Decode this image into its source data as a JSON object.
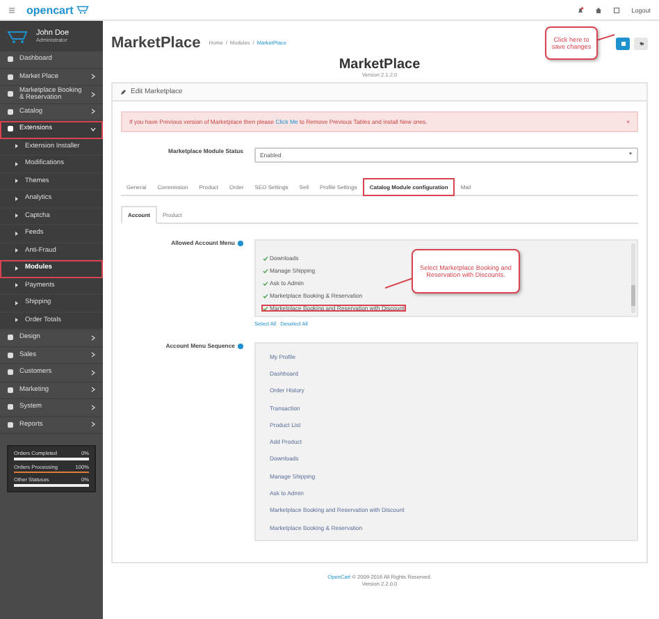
{
  "header": {
    "logo": "opencart",
    "logout": "Logout"
  },
  "user": {
    "name": "John Doe",
    "role": "Administrator"
  },
  "sidebar": {
    "items": [
      {
        "label": "Dashboard",
        "selected": false,
        "annotated": false
      },
      {
        "label": "Market Place",
        "expanded": false,
        "selected": false,
        "annotated": false
      },
      {
        "label": "Marketplace Booking & Reservation",
        "expanded": false,
        "selected": false,
        "annotated": false
      },
      {
        "label": "Catalog",
        "expanded": false,
        "selected": false,
        "annotated": false
      },
      {
        "label": "Extensions",
        "expanded": true,
        "selected": true,
        "annotated": true,
        "children": [
          {
            "label": "Extension Installer",
            "selected": false,
            "annotated": false
          },
          {
            "label": "Modifications",
            "selected": false,
            "annotated": false
          },
          {
            "label": "Themes",
            "selected": false,
            "annotated": false
          },
          {
            "label": "Analytics",
            "selected": false,
            "annotated": false
          },
          {
            "label": "Captcha",
            "selected": false,
            "annotated": false
          },
          {
            "label": "Feeds",
            "selected": false,
            "annotated": false
          },
          {
            "label": "Anti-Fraud",
            "selected": false,
            "annotated": false
          },
          {
            "label": "Modules",
            "selected": true,
            "annotated": true
          },
          {
            "label": "Payments",
            "selected": false,
            "annotated": false
          },
          {
            "label": "Shipping",
            "selected": false,
            "annotated": false
          },
          {
            "label": "Order Totals",
            "selected": false,
            "annotated": false
          }
        ]
      },
      {
        "label": "Design",
        "expanded": false,
        "selected": false,
        "annotated": false
      },
      {
        "label": "Sales",
        "expanded": false,
        "selected": false,
        "annotated": false
      },
      {
        "label": "Customers",
        "expanded": false,
        "selected": false,
        "annotated": false
      },
      {
        "label": "Marketing",
        "expanded": false,
        "selected": false,
        "annotated": false
      },
      {
        "label": "System",
        "expanded": false,
        "selected": false,
        "annotated": false
      },
      {
        "label": "Reports",
        "expanded": false,
        "selected": false,
        "annotated": false
      }
    ]
  },
  "stats": [
    {
      "label": "Orders Completed",
      "reading": "0%",
      "level": 0
    },
    {
      "label": "Orders Processing",
      "reading": "100%",
      "level": 1
    },
    {
      "label": "Other Statuses",
      "reading": "0%",
      "level": 0
    }
  ],
  "page": {
    "title": "MarketPlace",
    "breadcrumb": [
      "Home",
      "Modules",
      "MarketPlace"
    ],
    "separator": "/"
  },
  "callouts": [
    {
      "kind": "save",
      "text": "Click here to save changes"
    },
    {
      "kind": "list",
      "text": "Select Marketplace Booking and Reservation with Discounts."
    }
  ],
  "heading": {
    "title": "MarketPlace",
    "version": "Version 2.1.2.0"
  },
  "panel": {
    "title": "Edit Marketplace",
    "alert": {
      "before": "If you have Previous version of Marketplace then please ",
      "link": "Click Me",
      "after": " to Remove Previous Tables and install New ones.",
      "close": "×"
    },
    "status": {
      "label": "Marketplace Module Status",
      "value": "Enabled"
    },
    "tabs": [
      {
        "label": "General",
        "selected": false,
        "annotated": false
      },
      {
        "label": "Commission",
        "selected": false,
        "annotated": false
      },
      {
        "label": "Product",
        "selected": false,
        "annotated": false
      },
      {
        "label": "Order",
        "selected": false,
        "annotated": false
      },
      {
        "label": "SEO Settings",
        "selected": false,
        "annotated": false
      },
      {
        "label": "Sell",
        "selected": false,
        "annotated": false
      },
      {
        "label": "Profile Settings",
        "selected": false,
        "annotated": false
      },
      {
        "label": "Catalog Module configuration",
        "selected": true,
        "annotated": true
      },
      {
        "label": "Mail",
        "selected": false,
        "annotated": false
      }
    ],
    "subtabs": [
      {
        "label": "Account",
        "selected": true
      },
      {
        "label": "Product",
        "selected": false
      }
    ],
    "allowed": {
      "label": "Allowed Account Menu",
      "items": [
        {
          "label": "Downloads",
          "checked": true,
          "annotated": false
        },
        {
          "label": "Manage Shipping",
          "checked": true,
          "annotated": false
        },
        {
          "label": "Ask to Admin",
          "checked": true,
          "annotated": false
        },
        {
          "label": "Marketplace Booking & Reservation",
          "checked": true,
          "annotated": false
        },
        {
          "label": "Marketplace Booking and Reservation with Discount",
          "checked": true,
          "annotated": true
        }
      ]
    },
    "select_all": "Select All",
    "deselect_all": "Deselect All",
    "sequence": {
      "label": "Account Menu Sequence",
      "items": [
        "My Profile",
        "Dashboard",
        "Order History",
        "Transaction",
        "Product List",
        "Add Product",
        "Downloads",
        "Manage Shipping",
        "Ask to Admin",
        "Marketplace Booking and Reservation with Discount",
        "Marketplace Booking & Reservation"
      ]
    }
  },
  "footer": {
    "link": "OpenCart",
    "text": " © 2009-2016 All Rights Reserved.",
    "version": "Version 2.2.0.0"
  }
}
